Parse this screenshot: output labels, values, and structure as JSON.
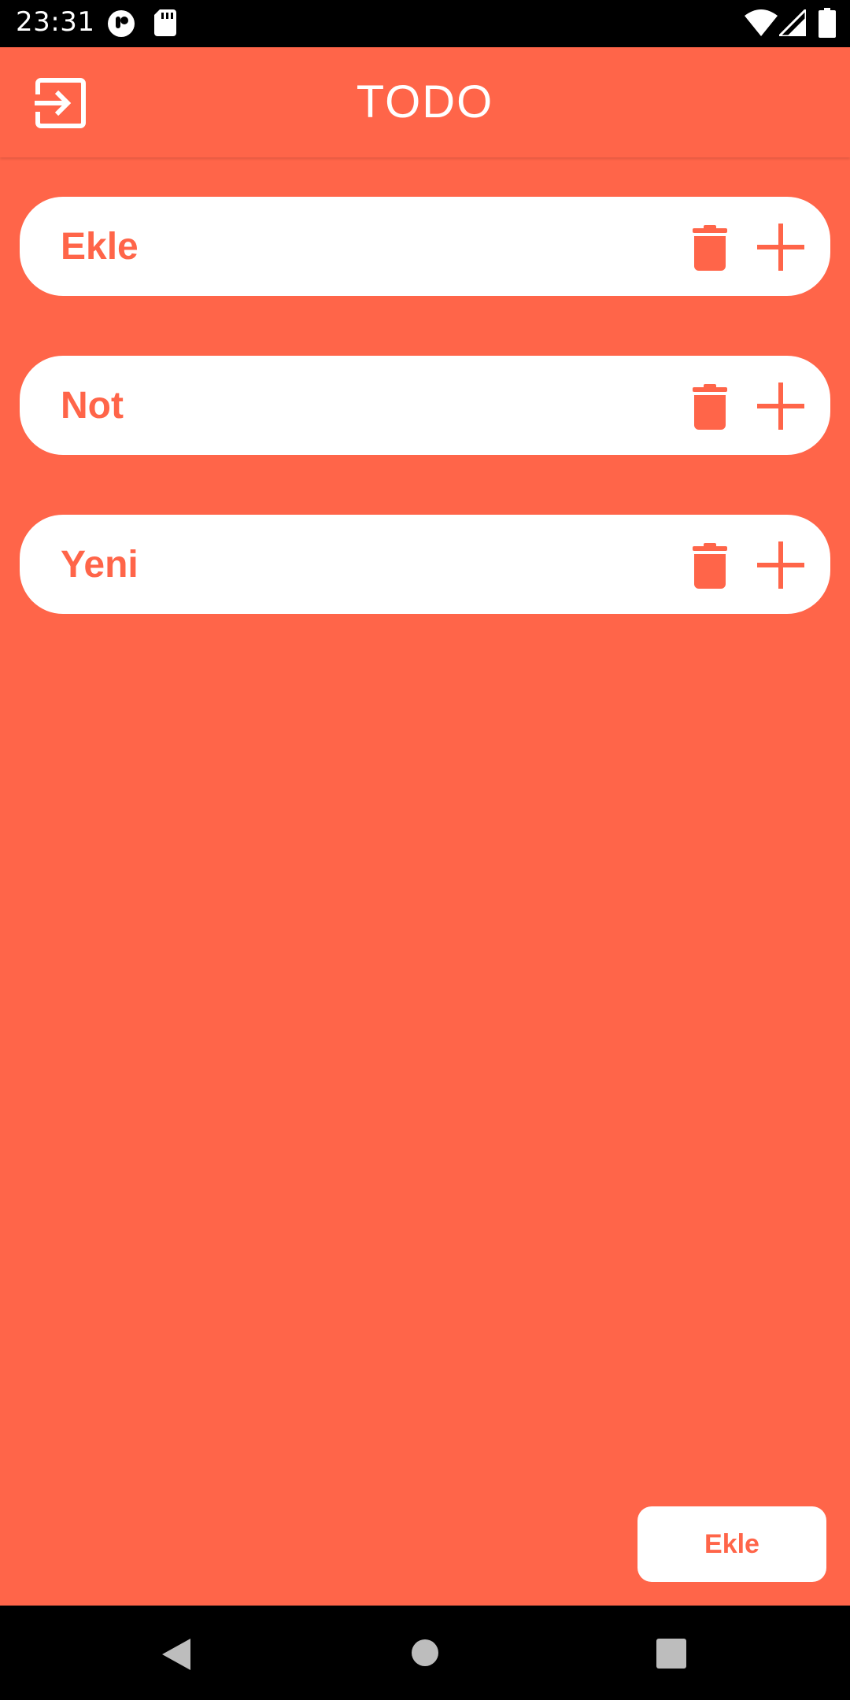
{
  "status_bar": {
    "time": "23:31",
    "icons": [
      "notification-icon",
      "sd-card-icon",
      "wifi-icon",
      "cell-signal-icon",
      "battery-icon"
    ]
  },
  "app_bar": {
    "title": "TODO",
    "logout_icon": "logout-icon"
  },
  "todos": [
    {
      "text": "Ekle"
    },
    {
      "text": "Not"
    },
    {
      "text": "Yeni"
    }
  ],
  "add_button": {
    "label": "Ekle"
  },
  "nav_bar": {
    "icons": [
      "back-icon",
      "home-icon",
      "recents-icon"
    ]
  },
  "colors": {
    "accent": "#FF6549",
    "card": "#FFFFFF",
    "bars": "#000000"
  }
}
